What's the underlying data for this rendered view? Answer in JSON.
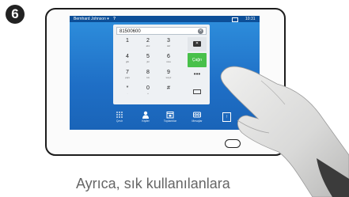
{
  "step_number": "6",
  "status_bar": {
    "user": "Bernhard Johnson",
    "time": "10:31"
  },
  "dialpad": {
    "entered_number": "81500600",
    "keys": [
      {
        "digit": "1",
        "letters": ""
      },
      {
        "digit": "2",
        "letters": "abc"
      },
      {
        "digit": "3",
        "letters": "def"
      },
      {
        "digit": "4",
        "letters": "ghi"
      },
      {
        "digit": "5",
        "letters": "jkl"
      },
      {
        "digit": "6",
        "letters": "mno"
      },
      {
        "digit": "7",
        "letters": "pqrs"
      },
      {
        "digit": "8",
        "letters": "tuv"
      },
      {
        "digit": "9",
        "letters": "wxyz"
      },
      {
        "digit": "*",
        "letters": "."
      },
      {
        "digit": "0",
        "letters": "+"
      },
      {
        "digit": "#",
        "letters": ""
      }
    ],
    "call_label": "Çağrı",
    "more_label": "•••"
  },
  "bottom_nav": [
    {
      "label": "Çevir",
      "icon": "keypad-icon"
    },
    {
      "label": "Kişiler",
      "icon": "person-icon"
    },
    {
      "label": "Toplantılar",
      "icon": "calendar-icon"
    },
    {
      "label": "Mesajlar",
      "icon": "voicemail-icon"
    }
  ],
  "caption": "Ayrıca, sık kullanılanlara",
  "colors": {
    "screen_blue": "#1f6fc6",
    "call_green": "#48c04a"
  }
}
